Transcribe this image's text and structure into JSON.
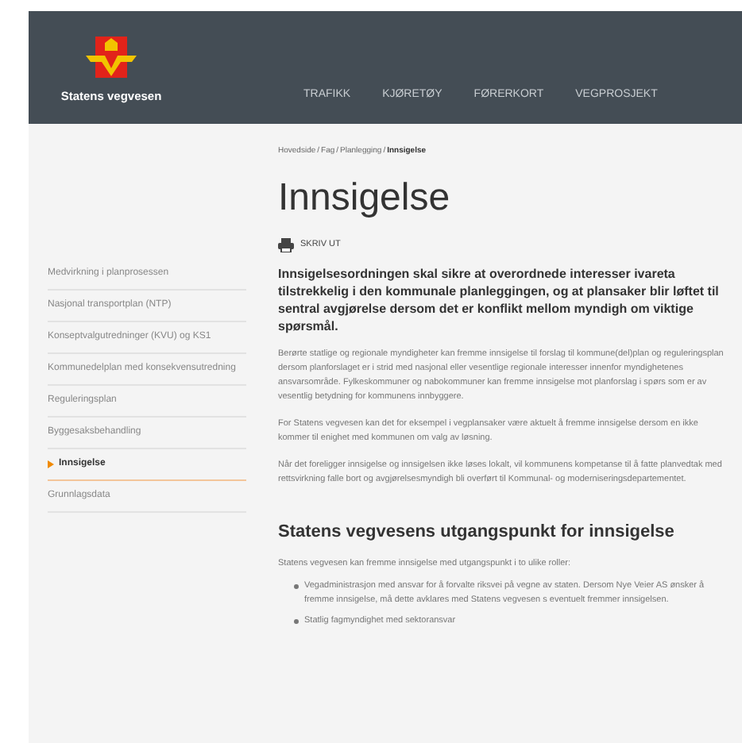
{
  "header": {
    "logo_text": "Statens vegvesen",
    "nav": [
      {
        "label": "TRAFIKK"
      },
      {
        "label": "KJØRETØY"
      },
      {
        "label": "FØRERKORT"
      },
      {
        "label": "VEGPROSJEKT"
      }
    ]
  },
  "breadcrumb_separator": "/",
  "breadcrumb": [
    {
      "label": "Hovedside",
      "current": false
    },
    {
      "label": "Fag",
      "current": false
    },
    {
      "label": "Planlegging",
      "current": false
    },
    {
      "label": "Innsigelse",
      "current": true
    }
  ],
  "sidebar": {
    "items": [
      {
        "label": "Medvirkning i planprosessen",
        "selected": false
      },
      {
        "label": "Nasjonal transportplan (NTP)",
        "selected": false
      },
      {
        "label": "Konseptvalgutredninger (KVU) og KS1",
        "selected": false
      },
      {
        "label": "Kommunedelplan med konsekvensutredning",
        "selected": false
      },
      {
        "label": "Reguleringsplan",
        "selected": false
      },
      {
        "label": "Byggesaksbehandling",
        "selected": false
      },
      {
        "label": "Innsigelse",
        "selected": true
      },
      {
        "label": "Grunnlagsdata",
        "selected": false
      }
    ]
  },
  "article": {
    "title": "Innsigelse",
    "print_label": "SKRIV UT",
    "lead": "Innsigelsesordningen skal sikre at overordnede interesser ivareta tilstrekkelig i den kommunale planleggingen, og at plansaker blir løftet til sentral avgjørelse dersom det er konflikt mellom myndigh om viktige spørsmål.",
    "paragraphs": [
      "Berørte statlige og regionale myndigheter kan fremme innsigelse til forslag til kommune(del)plan og reguleringsplan dersom planforslaget er i strid med nasjonal eller vesentlige regionale interesser innenfor myndighetenes ansvarsområde. Fylkeskommuner og nabokommuner kan fremme innsigelse mot planforslag i spørs som er av vesentlig betydning for kommunens innbyggere.",
      "For Statens vegvesen kan det for eksempel i vegplansaker være aktuelt å fremme innsigelse dersom en ikke kommer til enighet med kommunen om valg av løsning.",
      "Når det foreligger innsigelse og innsigelsen ikke løses lokalt, vil kommunens kompetanse til å fatte planvedtak med rettsvirkning falle bort og avgjørelsesmyndigh bli overført til Kommunal- og moderniseringsdepartementet."
    ],
    "section_title": "Statens vegvesens utgangspunkt for innsigelse",
    "section_intro": "Statens vegvesen kan fremme innsigelse med utgangspunkt i to ulike roller:",
    "bullets": [
      "Vegadministrasjon med ansvar for å forvalte riksvei på vegne av staten. Dersom Nye Veier AS ønsker å fremme innsigelse, må dette avklares med Statens vegvesen s eventuelt fremmer innsigelsen.",
      "Statlig fagmyndighet med sektoransvar"
    ]
  }
}
